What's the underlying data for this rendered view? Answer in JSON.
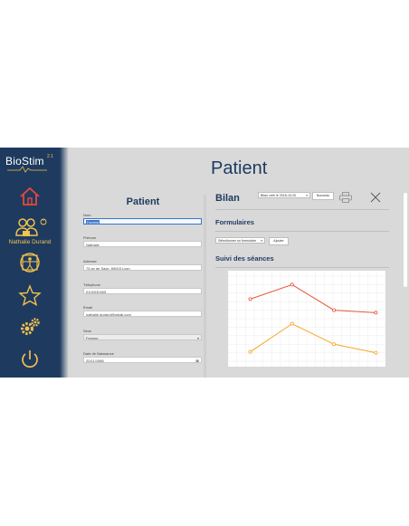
{
  "app": {
    "logo_bio": "Bio",
    "logo_stim": "Stim",
    "version": "2.1",
    "colors": {
      "sidebar": "#1e3a5f",
      "accent": "#f2c14e",
      "icon_red": "#e8473c",
      "title": "#1e3a5f"
    }
  },
  "sidebar": {
    "user_name": "Nathalie Durand",
    "items": [
      {
        "icon": "home-icon"
      },
      {
        "icon": "user-session-icon"
      },
      {
        "icon": "vitruvian-man-icon"
      },
      {
        "icon": "star-icon"
      },
      {
        "icon": "gears-icon"
      },
      {
        "icon": "power-icon"
      }
    ]
  },
  "header": {
    "title": "Patient"
  },
  "patient_form": {
    "title": "Patient",
    "fields": [
      {
        "label": "Nom",
        "value": "Durand"
      },
      {
        "label": "Prénom",
        "value": "Nathalie"
      },
      {
        "label": "Adresse",
        "value": "75 av de Saxe, 69003 Lyon"
      },
      {
        "label": "Téléphone",
        "value": "0102030405"
      },
      {
        "label": "Email",
        "value": "nathalie.durand@gmail.com"
      },
      {
        "label": "Sexe",
        "value": "Femme"
      },
      {
        "label": "Date de Naissance",
        "value": "20/11/1986"
      }
    ]
  },
  "bilan": {
    "title": "Bilan",
    "selected": "Bilan créé le 2016-10-20",
    "new_label": "Nouveau",
    "forms_title": "Formulaires",
    "forms_placeholder": "Sélectionner un formulaire",
    "add_label": "Ajouter",
    "sessions_title": "Suivi des séances"
  },
  "chart_data": {
    "type": "line",
    "x": [
      1,
      2,
      3,
      4
    ],
    "ylim": [
      0,
      10
    ],
    "grid": true,
    "series": [
      {
        "values": [
          7.3,
          9.0,
          6.0,
          5.7
        ],
        "color": "#e8553a"
      },
      {
        "values": [
          1.1,
          4.4,
          2.0,
          1.0
        ],
        "color": "#f5a623"
      }
    ]
  }
}
